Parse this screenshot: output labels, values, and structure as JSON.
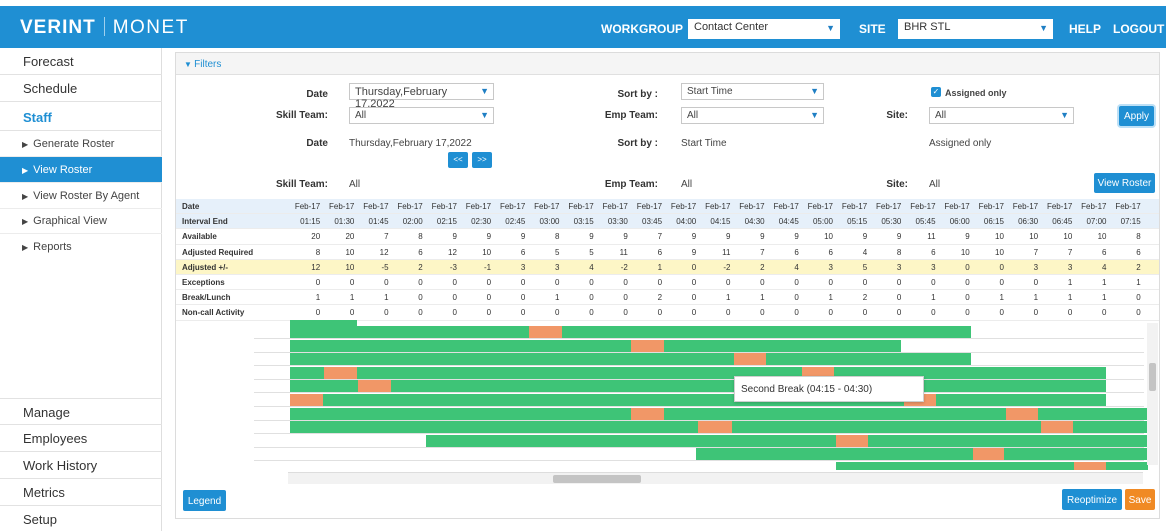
{
  "header": {
    "brand": "VERINT",
    "product": "MONET",
    "workgroup_label": "WORKGROUP",
    "workgroup_value": "Contact Center",
    "site_label": "SITE",
    "site_value": "BHR STL",
    "help": "HELP",
    "logout": "LOGOUT"
  },
  "sidebar": {
    "top": [
      "Forecast",
      "Schedule",
      "Staff"
    ],
    "sub": [
      "Generate Roster",
      "View Roster",
      "View Roster By Agent",
      "Graphical View",
      "Reports"
    ],
    "bottom": [
      "Manage",
      "Employees",
      "Work History",
      "Metrics",
      "Setup"
    ]
  },
  "filters": {
    "title": "Filters",
    "date_label": "Date",
    "date_value": "Thursday,February 17,2022",
    "sort_label": "Sort by :",
    "sort_value": "Start Time",
    "assigned_label": "Assigned only",
    "skill_label": "Skill Team:",
    "skill_value": "All",
    "emp_label": "Emp Team:",
    "emp_value": "All",
    "site_label": "Site:",
    "site_value": "All",
    "apply": "Apply",
    "summary_date_label": "Date",
    "summary_date": "Thursday,February 17,2022",
    "summary_sort_label": "Sort by :",
    "summary_sort": "Start Time",
    "summary_assigned": "Assigned only",
    "prev": "<<",
    "next": ">>",
    "summary_skill_label": "Skill Team:",
    "summary_skill": "All",
    "summary_emp_label": "Emp Team:",
    "summary_emp": "All",
    "summary_site_label": "Site:",
    "summary_site": "All",
    "view_roster": "View Roster"
  },
  "grid": {
    "rows": [
      {
        "label": "Date",
        "values": [
          "Feb-17",
          "Feb-17",
          "Feb-17",
          "Feb-17",
          "Feb-17",
          "Feb-17",
          "Feb-17",
          "Feb-17",
          "Feb-17",
          "Feb-17",
          "Feb-17",
          "Feb-17",
          "Feb-17",
          "Feb-17",
          "Feb-17",
          "Feb-17",
          "Feb-17",
          "Feb-17",
          "Feb-17",
          "Feb-17",
          "Feb-17",
          "Feb-17",
          "Feb-17",
          "Feb-17",
          "Feb-17"
        ]
      },
      {
        "label": "Interval End",
        "values": [
          "01:15",
          "01:30",
          "01:45",
          "02:00",
          "02:15",
          "02:30",
          "02:45",
          "03:00",
          "03:15",
          "03:30",
          "03:45",
          "04:00",
          "04:15",
          "04:30",
          "04:45",
          "05:00",
          "05:15",
          "05:30",
          "05:45",
          "06:00",
          "06:15",
          "06:30",
          "06:45",
          "07:00",
          "07:15"
        ]
      },
      {
        "label": "Available",
        "values": [
          "20",
          "20",
          "7",
          "8",
          "9",
          "9",
          "9",
          "8",
          "9",
          "9",
          "7",
          "9",
          "9",
          "9",
          "9",
          "10",
          "9",
          "9",
          "11",
          "9",
          "10",
          "10",
          "10",
          "10",
          "8"
        ]
      },
      {
        "label": "Adjusted Required",
        "values": [
          "8",
          "10",
          "12",
          "6",
          "12",
          "10",
          "6",
          "5",
          "5",
          "11",
          "6",
          "9",
          "11",
          "7",
          "6",
          "6",
          "4",
          "8",
          "6",
          "10",
          "10",
          "7",
          "7",
          "6",
          "6"
        ]
      },
      {
        "label": "Adjusted +/-",
        "values": [
          "12",
          "10",
          "-5",
          "2",
          "-3",
          "-1",
          "3",
          "3",
          "4",
          "-2",
          "1",
          "0",
          "-2",
          "2",
          "4",
          "3",
          "5",
          "3",
          "3",
          "0",
          "0",
          "3",
          "3",
          "4",
          "2"
        ]
      },
      {
        "label": "Exceptions",
        "values": [
          "0",
          "0",
          "0",
          "0",
          "0",
          "0",
          "0",
          "0",
          "0",
          "0",
          "0",
          "0",
          "0",
          "0",
          "0",
          "0",
          "0",
          "0",
          "0",
          "0",
          "0",
          "0",
          "1",
          "1",
          "1"
        ]
      },
      {
        "label": "Break/Lunch",
        "values": [
          "1",
          "1",
          "1",
          "0",
          "0",
          "0",
          "0",
          "1",
          "0",
          "0",
          "2",
          "0",
          "1",
          "1",
          "0",
          "1",
          "2",
          "0",
          "1",
          "0",
          "1",
          "1",
          "1",
          "1",
          "0"
        ]
      },
      {
        "label": "Non-call Activity",
        "values": [
          "0",
          "0",
          "0",
          "0",
          "0",
          "0",
          "0",
          "0",
          "0",
          "0",
          "0",
          "0",
          "0",
          "0",
          "0",
          "0",
          "0",
          "0",
          "0",
          "0",
          "0",
          "0",
          "0",
          "0",
          "0"
        ]
      }
    ]
  },
  "gantt": {
    "tooltip": "Second Break (04:15 - 04:30)"
  },
  "footer": {
    "legend": "Legend",
    "reoptimize": "Reoptimize",
    "save": "Save"
  },
  "colors": {
    "primary": "#1f8fd3",
    "shift": "#3ec477",
    "break": "#f19767",
    "adjusted_row": "#fdf6c6"
  }
}
